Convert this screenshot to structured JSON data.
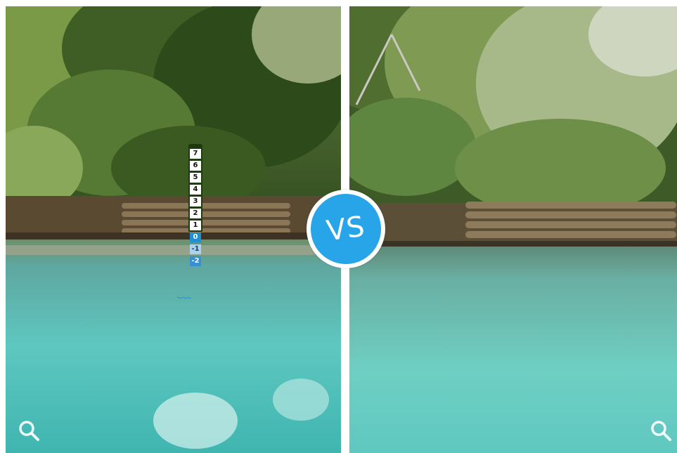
{
  "comparison": {
    "badge_label": "VS",
    "badge_color": "#27a5e8"
  },
  "gauge": {
    "marks": [
      "7",
      "6",
      "5",
      "4",
      "3",
      "2",
      "1",
      "0",
      "-1",
      "-2"
    ]
  },
  "icons": {
    "left_zoom": "magnifier-icon",
    "right_zoom": "magnifier-icon"
  }
}
